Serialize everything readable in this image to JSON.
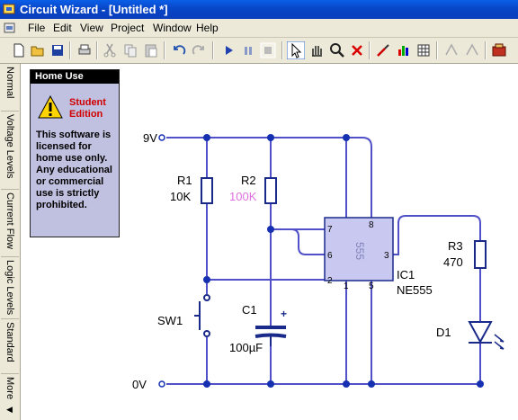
{
  "window": {
    "title": "Circuit Wizard - [Untitled *]"
  },
  "menu": [
    "File",
    "Edit",
    "View",
    "Project",
    "Window",
    "Help"
  ],
  "toolbar": [
    "new-icon",
    "open-icon",
    "save-icon",
    "print-icon",
    "cut-icon",
    "copy-icon",
    "paste-icon",
    "undo-icon",
    "redo-icon",
    "play-icon",
    "pause-icon",
    "stop-icon",
    "select-pointer-icon",
    "pan-hand-icon",
    "zoom-icon",
    "delete-icon",
    "probe-icon",
    "graph-icon",
    "table-icon",
    "rotate-left-icon",
    "rotate-right-icon",
    "component-gallery-icon"
  ],
  "side_tabs": [
    "Normal",
    "Voltage Levels",
    "Current Flow",
    "Logic Levels",
    "Standard",
    "More"
  ],
  "notice": {
    "header": "Home Use",
    "edition": "Student Edition",
    "text": "This software is licensed for home use only. Any educational or commercial use is strictly prohibited."
  },
  "schematic": {
    "supply_label": "9V",
    "ground_label": "0V",
    "r1": {
      "name": "R1",
      "value": "10K"
    },
    "r2": {
      "name": "R2",
      "value": "100K"
    },
    "r3": {
      "name": "R3",
      "value": "470"
    },
    "c1": {
      "name": "C1",
      "value": "100µF",
      "polarity": "+"
    },
    "sw1": {
      "name": "SW1"
    },
    "d1": {
      "name": "D1"
    },
    "ic1": {
      "name": "IC1",
      "part": "NE555",
      "body_label": "555",
      "pins": [
        "7",
        "8",
        "6",
        "3",
        "2",
        "1",
        "5"
      ]
    },
    "colors": {
      "wire": "#5050c8",
      "node": "#1530b0",
      "ic_fill": "#c8c8f0",
      "r2_value": "#e070e0",
      "component": "#1a2a8a"
    }
  }
}
